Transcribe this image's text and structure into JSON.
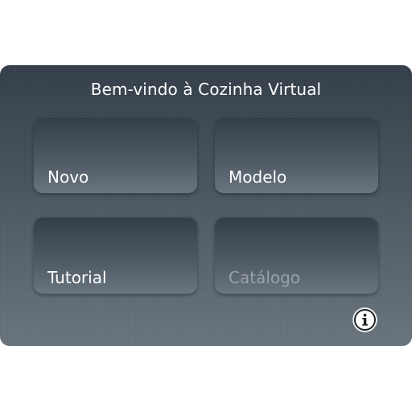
{
  "dialog": {
    "title": "Bem-vindo à Cozinha Virtual",
    "tiles": [
      {
        "label": "Novo",
        "enabled": true
      },
      {
        "label": "Modelo",
        "enabled": true
      },
      {
        "label": "Tutorial",
        "enabled": true
      },
      {
        "label": "Catálogo",
        "enabled": false
      }
    ],
    "info_icon": "info-icon"
  },
  "colors": {
    "title_text": "#ffffff",
    "label_text": "#ffffff",
    "disabled_label_text": "#9aa1a7",
    "panel_top": "#343f49",
    "panel_bottom": "#6a757e"
  }
}
